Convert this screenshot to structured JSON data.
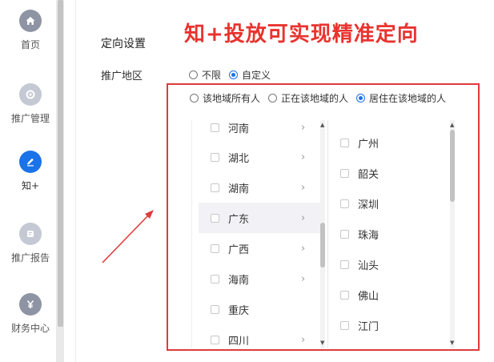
{
  "nav": {
    "items": [
      {
        "label": "首页",
        "icon": "home-icon",
        "color": "#8e94a3"
      },
      {
        "label": "推广管理",
        "icon": "gear-icon",
        "color": "#c4c9d4"
      },
      {
        "label": "知+",
        "icon": "pen-icon",
        "color": "#1a73e8"
      },
      {
        "label": "推广报告",
        "icon": "report-icon",
        "color": "#c4c9d4"
      },
      {
        "label": "财务中心",
        "icon": "yuan-icon",
        "color": "#8e94a3"
      }
    ],
    "active_index": 2
  },
  "section_title": "定向设置",
  "headline": "知+投放可实现精准定向",
  "region": {
    "label": "推广地区",
    "mode_options": [
      {
        "label": "不限",
        "checked": false
      },
      {
        "label": "自定义",
        "checked": true
      }
    ],
    "scope_options": [
      {
        "label": "该地域所有人",
        "checked": false
      },
      {
        "label": "正在该地域的人",
        "checked": false
      },
      {
        "label": "居住在该地域的人",
        "checked": true
      }
    ],
    "provinces": [
      {
        "name": "河南",
        "has_children": true
      },
      {
        "name": "湖北",
        "has_children": true
      },
      {
        "name": "湖南",
        "has_children": true
      },
      {
        "name": "广东",
        "has_children": true
      },
      {
        "name": "广西",
        "has_children": true
      },
      {
        "name": "海南",
        "has_children": true
      },
      {
        "name": "重庆",
        "has_children": false
      },
      {
        "name": "四川",
        "has_children": true
      }
    ],
    "selected_province_index": 3,
    "cities": [
      "广州",
      "韶关",
      "深圳",
      "珠海",
      "汕头",
      "佛山",
      "江门"
    ]
  },
  "colors": {
    "accent": "#1a73e8",
    "highlight_red": "#e03a3a",
    "headline_red": "#e9332f"
  },
  "icons": {
    "chevron": "›",
    "scroll_up": "▲",
    "scroll_down": "▼"
  }
}
